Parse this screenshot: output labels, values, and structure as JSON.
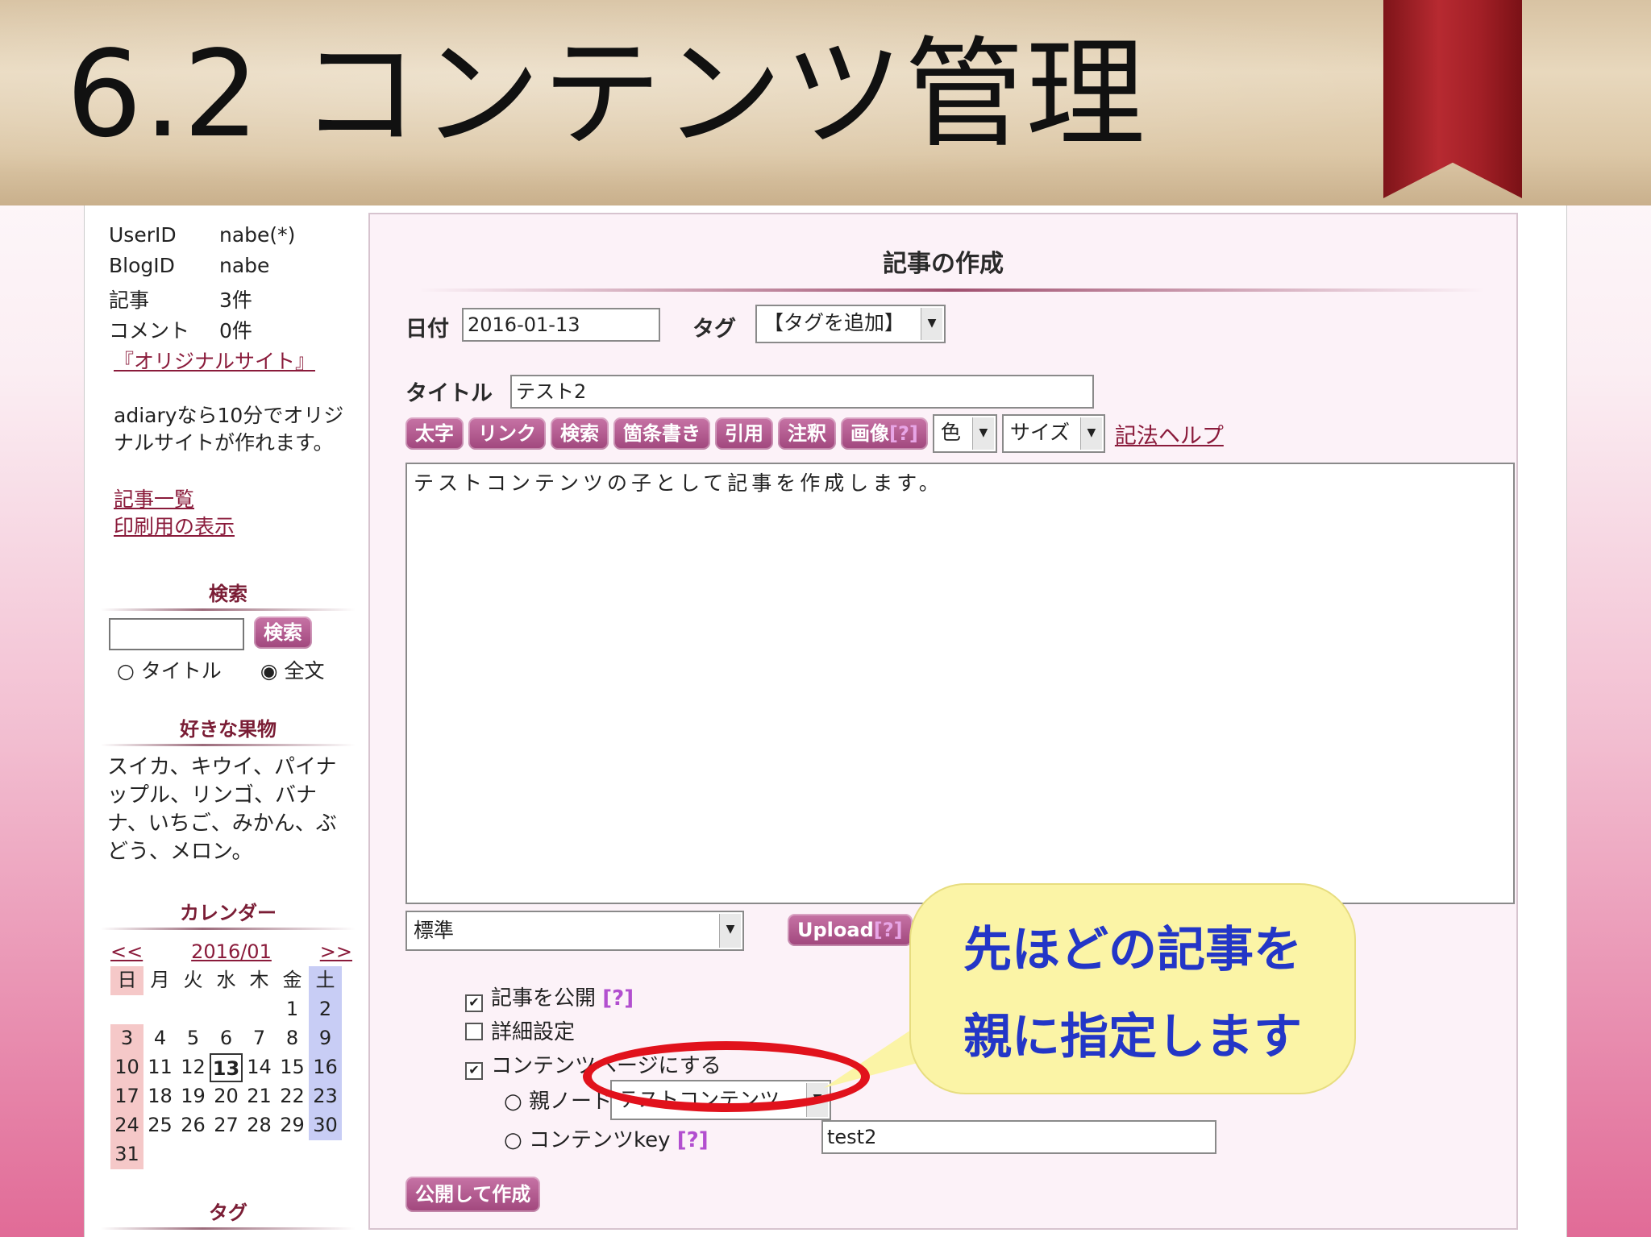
{
  "slide": {
    "title": "6.2 コンテンツ管理"
  },
  "sidebar": {
    "info": [
      {
        "key": "UserID",
        "value": "nabe(*)"
      },
      {
        "key": "BlogID",
        "value": "nabe"
      },
      {
        "key": "記事",
        "value": "3件"
      },
      {
        "key": "コメント",
        "value": "0件"
      }
    ],
    "original_site_link": "『オリジナルサイト』",
    "promo_text": "adiaryなら10分でオリジナルサイトが作れます。",
    "links": [
      "記事一覧",
      "印刷用の表示"
    ],
    "search": {
      "heading": "検索",
      "button_label": "検索",
      "input_value": "",
      "options": [
        "タイトル",
        "全文"
      ],
      "selected_option": "全文"
    },
    "favorite": {
      "heading": "好きな果物",
      "text": "スイカ、キウイ、パイナップル、リンゴ、バナナ、いちご、みかん、ぶどう、メロン。"
    },
    "calendar": {
      "heading": "カレンダー",
      "prev": "<<",
      "month": "2016/01",
      "next": ">>",
      "weekdays": [
        "日",
        "月",
        "火",
        "水",
        "木",
        "金",
        "土"
      ],
      "weeks": [
        [
          "",
          "",
          "",
          "",
          "",
          "1",
          "2"
        ],
        [
          "3",
          "4",
          "5",
          "6",
          "7",
          "8",
          "9"
        ],
        [
          "10",
          "11",
          "12",
          "13",
          "14",
          "15",
          "16"
        ],
        [
          "17",
          "18",
          "19",
          "20",
          "21",
          "22",
          "23"
        ],
        [
          "24",
          "25",
          "26",
          "27",
          "28",
          "29",
          "30"
        ],
        [
          "31",
          "",
          "",
          "",
          "",
          "",
          ""
        ]
      ],
      "today": "13"
    },
    "tag_heading": "タグ"
  },
  "form": {
    "title": "記事の作成",
    "date_label": "日付",
    "date_value": "2016-01-13",
    "tag_label": "タグ",
    "tag_select": "【タグを追加】",
    "title_label": "タイトル",
    "title_value": "テスト2",
    "toolbar": {
      "buttons": [
        "太字",
        "リンク",
        "検索",
        "箇条書き",
        "引用",
        "注釈",
        "画像"
      ],
      "image_help": "[?]",
      "color_select": "色",
      "size_select": "サイズ",
      "help_link": "記法ヘルプ"
    },
    "body_text": "テストコンテンツの子として記事を作成します。",
    "parser_select": "標準",
    "upload_label": "Upload",
    "upload_help": "[?]",
    "options": {
      "publish": {
        "label": "記事を公開",
        "help": "[?]",
        "checked": true
      },
      "detail": {
        "label": "詳細設定",
        "checked": false
      },
      "content_page": {
        "label": "コンテンツページにする",
        "checked": true
      },
      "parent_node_label": "親ノード",
      "parent_node_value": "テストコンテンツ",
      "content_key_label": "コンテンツkey",
      "content_key_help": "[?]",
      "content_key_value": "test2"
    },
    "submit_label": "公開して作成"
  },
  "callout": {
    "line1": "先ほどの記事を",
    "line2": "親に指定します"
  }
}
